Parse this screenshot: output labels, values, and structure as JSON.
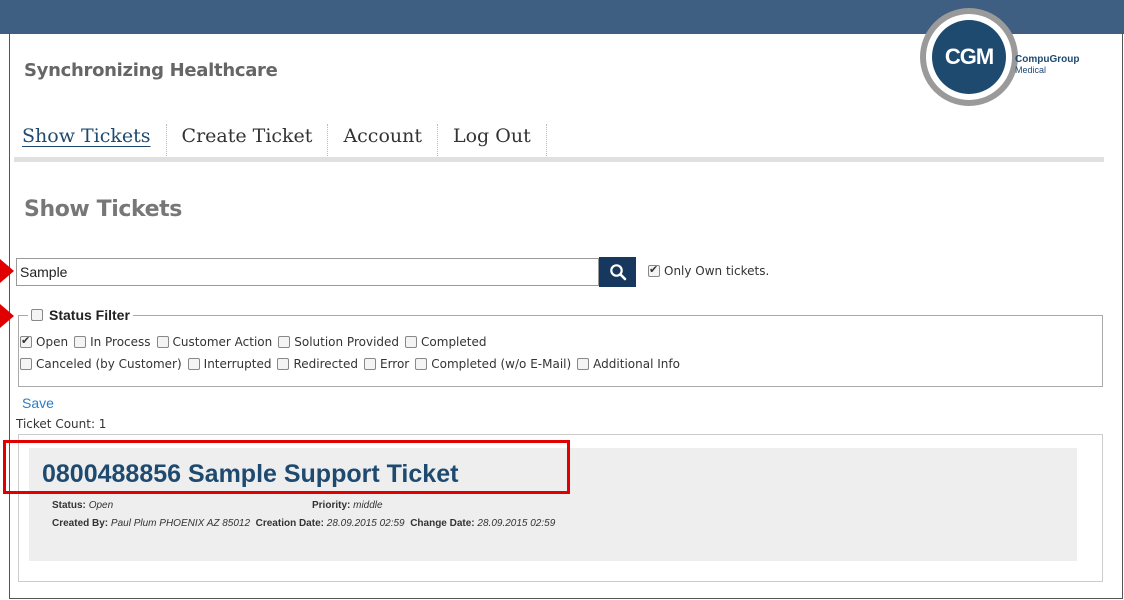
{
  "header": {
    "tagline": "Synchronizing Healthcare",
    "logo": {
      "mark": "CGM",
      "brand_line1": "CompuGroup",
      "brand_line2": "Medical"
    },
    "bar_color": "#3e5f82"
  },
  "nav": {
    "items": [
      {
        "label": "Show Tickets",
        "active": true
      },
      {
        "label": "Create Ticket",
        "active": false
      },
      {
        "label": "Account",
        "active": false
      },
      {
        "label": "Log Out",
        "active": false
      }
    ]
  },
  "page": {
    "title": "Show Tickets"
  },
  "search": {
    "value": "Sample",
    "button_icon": "search-icon",
    "own_tickets_label": "Only Own tickets.",
    "own_tickets_checked": true
  },
  "status_filter": {
    "legend": "Status Filter",
    "legend_checked": false,
    "row1": [
      {
        "label": "Open",
        "checked": true
      },
      {
        "label": "In Process",
        "checked": false
      },
      {
        "label": "Customer Action",
        "checked": false
      },
      {
        "label": "Solution Provided",
        "checked": false
      },
      {
        "label": "Completed",
        "checked": false
      }
    ],
    "row2": [
      {
        "label": "Canceled (by Customer)",
        "checked": false
      },
      {
        "label": "Interrupted",
        "checked": false
      },
      {
        "label": "Redirected",
        "checked": false
      },
      {
        "label": "Error",
        "checked": false
      },
      {
        "label": "Completed (w/o E-Mail)",
        "checked": false
      },
      {
        "label": "Additional Info",
        "checked": false
      }
    ]
  },
  "save_label": "Save",
  "ticket_count": "Ticket Count: 1",
  "ticket": {
    "title": "0800488856 Sample Support Ticket",
    "status_label": "Status:",
    "status_value": "Open",
    "priority_label": "Priority:",
    "priority_value": "middle",
    "created_by_label": "Created By:",
    "created_by_value": "Paul Plum PHOENIX AZ 85012",
    "creation_date_label": "Creation Date:",
    "creation_date_value": "28.09.2015 02:59",
    "change_date_label": "Change Date:",
    "change_date_value": "28.09.2015 02:59"
  },
  "colors": {
    "accent": "#1f4a70",
    "annotation": "#e00000",
    "link": "#2a7ec9"
  }
}
